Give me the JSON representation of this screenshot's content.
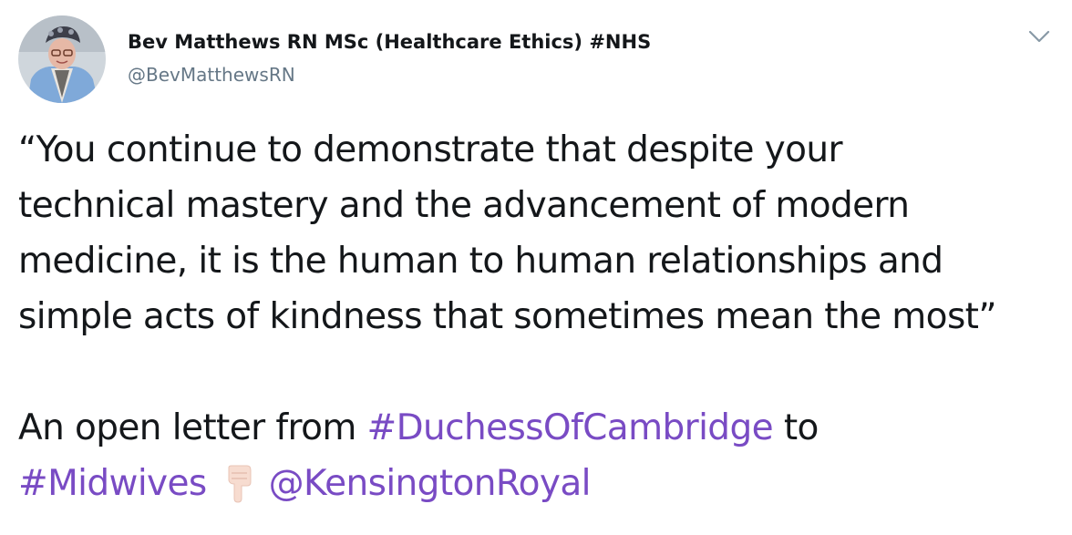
{
  "author": {
    "display_name": "Bev Matthews RN MSc (Healthcare Ethics) #NHS",
    "handle": "@BevMatthewsRN"
  },
  "menu_icon": "chevron-down-icon",
  "tweet": {
    "quote_lines": [
      "“You continue to demonstrate that despite your",
      "technical mastery and the advancement of modern",
      "medicine, it is the human to human relationships and",
      "simple acts of kindness that sometimes mean the most”"
    ],
    "letter_prefix": "An open letter from ",
    "hashtag_duchess": "#DuchessOfCambridge",
    "letter_suffix": " to",
    "hashtag_midwives": "#Midwives",
    "emoji": "backhand-index-pointing-down-icon",
    "mention": "@KensingtonRoyal"
  },
  "colors": {
    "link": "#794bc4",
    "text": "#14171a",
    "secondary": "#657786"
  }
}
